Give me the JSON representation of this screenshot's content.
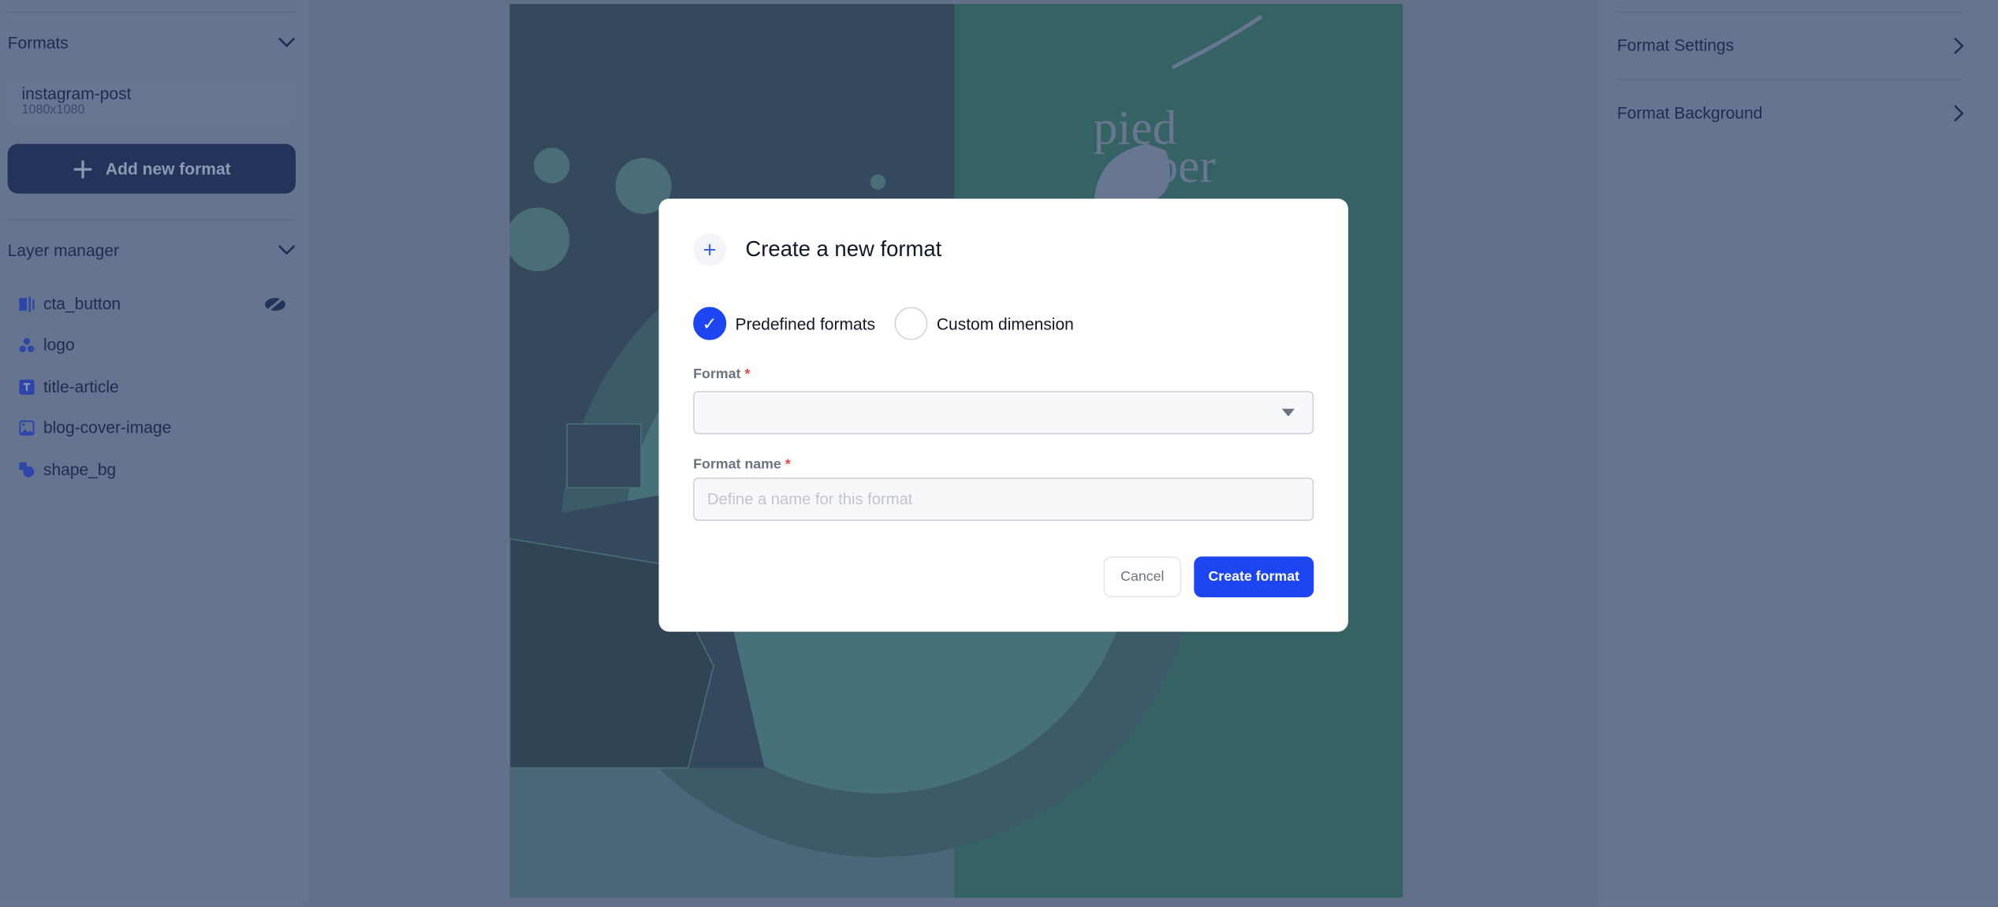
{
  "sidebar": {
    "formats_title": "Formats",
    "formats": [
      {
        "name": "instagram-post",
        "size": "1080x1080"
      }
    ],
    "add_format_label": "Add new format",
    "layer_title": "Layer manager",
    "layers": [
      {
        "label": "cta_button",
        "icon": "button-icon",
        "hidden": true
      },
      {
        "label": "logo",
        "icon": "shapes-icon"
      },
      {
        "label": "title-article",
        "icon": "text-icon"
      },
      {
        "label": "blog-cover-image",
        "icon": "image-icon"
      },
      {
        "label": "shape_bg",
        "icon": "shape-icon"
      }
    ]
  },
  "canvas": {
    "logo_text": [
      "pied",
      "piper"
    ],
    "left_color": "#34495b",
    "right_color": "#356363"
  },
  "right_panel": {
    "items": [
      {
        "label": "Format Settings"
      },
      {
        "label": "Format Background"
      }
    ]
  },
  "modal": {
    "title": "Create a new format",
    "options": [
      {
        "label": "Predefined formats",
        "selected": true
      },
      {
        "label": "Custom dimension",
        "selected": false
      }
    ],
    "format_label": "Format",
    "format_value": "",
    "name_label": "Format name",
    "name_placeholder": "Define a name for this format",
    "required_mark": "*",
    "cancel_label": "Cancel",
    "create_label": "Create format",
    "accent": "#1d46f2"
  }
}
